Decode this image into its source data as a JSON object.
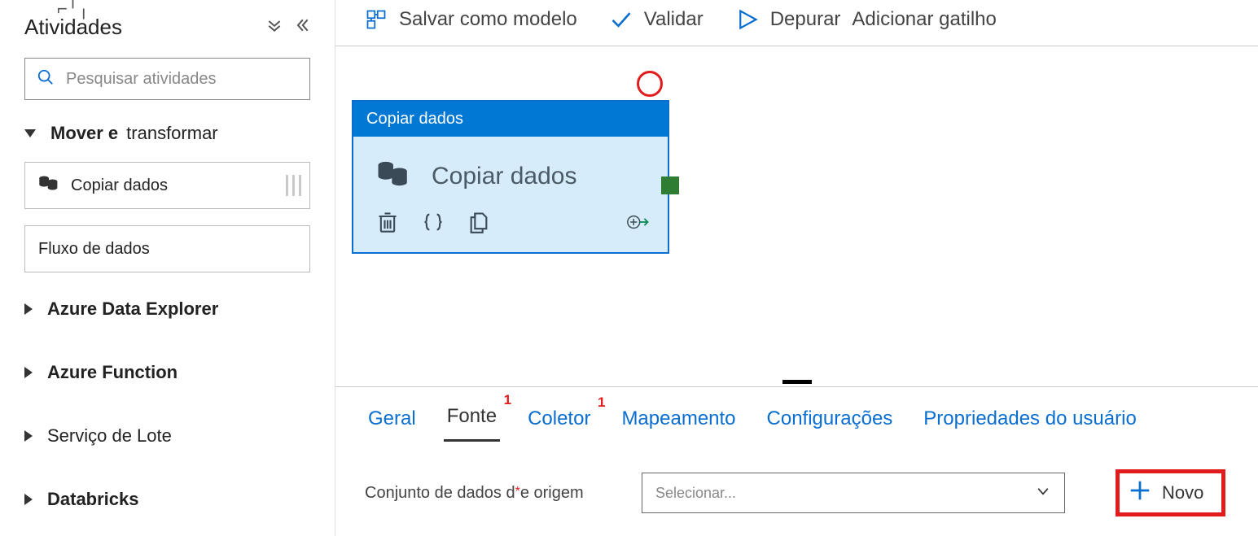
{
  "sidebar": {
    "title": "Atividades",
    "search_placeholder": "Pesquisar atividades",
    "expanded_category": {
      "part1": "Mover e",
      "part2": "transformar"
    },
    "items": [
      {
        "label": "Copiar dados",
        "icon": "database-pair-icon"
      },
      {
        "label": "Fluxo de dados",
        "icon": ""
      }
    ],
    "categories": [
      "Azure Data Explorer",
      "Azure Function",
      "Serviço de Lote",
      "Databricks"
    ]
  },
  "toolbar": {
    "save_template": "Salvar como modelo",
    "validate": "Validar",
    "debug": "Depurar",
    "add_trigger": "Adicionar gatilho"
  },
  "canvas": {
    "node_header": "Copiar dados",
    "node_title": "Copiar dados"
  },
  "props": {
    "tabs": {
      "general": "Geral",
      "source": "Fonte",
      "sink": "Coletor",
      "mapping": "Mapeamento",
      "settings": "Configurações",
      "user_props": "Propriedades do usuário",
      "badge_source": "1",
      "badge_sink": "1"
    },
    "source_form": {
      "label_prefix": "Conjunto de dados d",
      "label_suffix": "e origem",
      "select_placeholder": "Selecionar...",
      "new_label": "Novo"
    }
  }
}
